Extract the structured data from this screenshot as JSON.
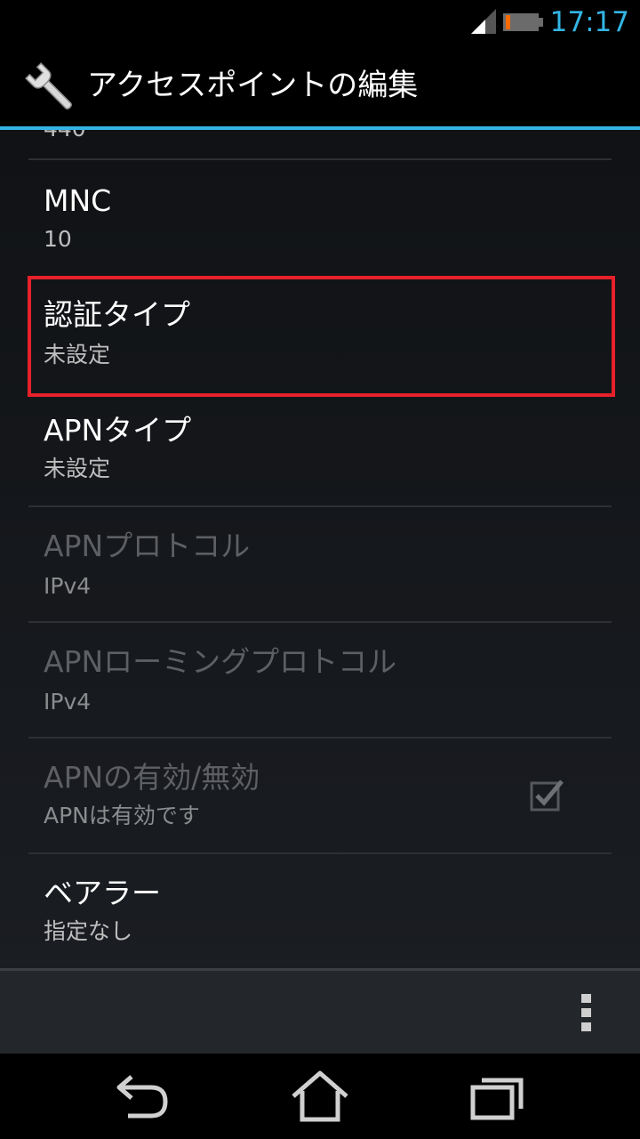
{
  "status_bar": {
    "time": "17:17"
  },
  "header": {
    "title": "アクセスポイントの編集"
  },
  "list": {
    "partial_top_summary": "440",
    "items": [
      {
        "title": "MNC",
        "summary": "10",
        "enabled": true
      },
      {
        "title": "認証タイプ",
        "summary": "未設定",
        "enabled": true,
        "highlighted": true
      },
      {
        "title": "APNタイプ",
        "summary": "未設定",
        "enabled": true
      },
      {
        "title": "APNプロトコル",
        "summary": "IPv4",
        "enabled": false
      },
      {
        "title": "APNローミングプロトコル",
        "summary": "IPv4",
        "enabled": false
      },
      {
        "title": "APNの有効/無効",
        "summary": "APNは有効です",
        "enabled": false,
        "checked": true
      },
      {
        "title": "ベアラー",
        "summary": "指定なし",
        "enabled": true
      }
    ]
  },
  "colors": {
    "accent": "#33b5e5",
    "highlight": "#e8202a",
    "battery_low": "#ff6a00"
  },
  "icons": {
    "app": "wrench-icon",
    "overflow": "overflow-menu-icon",
    "back": "back-icon",
    "home": "home-icon",
    "recents": "recents-icon"
  }
}
